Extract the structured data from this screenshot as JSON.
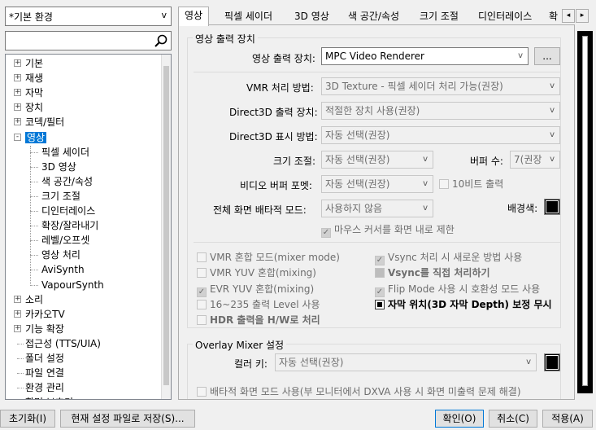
{
  "profile_select": "*기본 환경",
  "tree": {
    "items": [
      {
        "label": "기본",
        "level": 0,
        "expander": "+"
      },
      {
        "label": "재생",
        "level": 0,
        "expander": "+"
      },
      {
        "label": "자막",
        "level": 0,
        "expander": "+"
      },
      {
        "label": "장치",
        "level": 0,
        "expander": "+"
      },
      {
        "label": "코덱/필터",
        "level": 0,
        "expander": "+"
      },
      {
        "label": "영상",
        "level": 0,
        "expander": "-"
      },
      {
        "label": "픽셀 세이더",
        "level": 1
      },
      {
        "label": "3D 영상",
        "level": 1
      },
      {
        "label": "색 공간/속성",
        "level": 1
      },
      {
        "label": "크기 조절",
        "level": 1
      },
      {
        "label": "디인터레이스",
        "level": 1
      },
      {
        "label": "확장/잘라내기",
        "level": 1
      },
      {
        "label": "레벨/오프셋",
        "level": 1
      },
      {
        "label": "영상 처리",
        "level": 1
      },
      {
        "label": "AviSynth",
        "level": 1
      },
      {
        "label": "VapourSynth",
        "level": 1
      },
      {
        "label": "소리",
        "level": 0,
        "expander": "+"
      },
      {
        "label": "카카오TV",
        "level": 0,
        "expander": "+"
      },
      {
        "label": "기능 확장",
        "level": 0,
        "expander": "+"
      },
      {
        "label": "접근성 (TTS/UIA)",
        "level": 0
      },
      {
        "label": "폴더 설정",
        "level": 0
      },
      {
        "label": "파일 연결",
        "level": 0
      },
      {
        "label": "환경 관리",
        "level": 0
      },
      {
        "label": "화면 보호기",
        "level": 0
      }
    ]
  },
  "tabs": [
    "영상",
    "픽셀 세이더",
    "3D 영상",
    "색 공간/속성",
    "크기 조절",
    "디인터레이스",
    "확"
  ],
  "output_group": {
    "legend": "영상 출력 장치",
    "device_label": "영상 출력 장치:",
    "device_value": "MPC Video Renderer",
    "more_button": "...",
    "vmr_label": "VMR 처리 방법:",
    "vmr_value": "3D Texture - 픽셀 세이더 처리 가능(권장)",
    "d3d_out_label": "Direct3D 출력 장치:",
    "d3d_out_value": "적절한 장치 사용(권장)",
    "d3d_disp_label": "Direct3D 표시 방법:",
    "d3d_disp_value": "자동 선택(권장)",
    "resize_label": "크기 조절:",
    "resize_value": "자동 선택(권장)",
    "buffer_label": "버퍼 수:",
    "buffer_value": "7(권장",
    "vbuf_label": "비디오 버퍼 포멧:",
    "vbuf_value": "자동 선택(권장)",
    "tenbit_label": "10비트 출력",
    "fullscreen_label": "전체 화면 배타적 모드:",
    "fullscreen_value": "사용하지 않음",
    "bgcolor_label": "배경색:",
    "mouse_label": "마우스 커서를 화면 내로 제한",
    "checks_left": [
      "VMR 혼합 모드(mixer mode)",
      "VMR YUV 혼합(mixing)",
      "EVR YUV 혼합(mixing)",
      "16~235 출력 Level 사용",
      "HDR 출력을 H/W로 처리"
    ],
    "checks_right": [
      "Vsync 처리 시 새로운 방법 사용",
      "Vsync를 직접 처리하기",
      "Flip Mode 사용 시 호환성 모드 사용",
      "자막 위치(3D 자막 Depth) 보정 무시"
    ]
  },
  "overlay_group": {
    "legend": "Overlay Mixer 설정",
    "colorkey_label": "컬러 키:",
    "colorkey_value": "자동 선택(권장)",
    "exclusive_label": "배타적 화면 모드 사용(부 모니터에서 DXVA 사용 시 화면 미출력 문제 해결)"
  },
  "bottom": {
    "reset": "초기화(I)",
    "save_current": "현재 설정 파일로 저장(S)...",
    "ok": "확인(O)",
    "cancel": "취소(C)",
    "apply": "적용(A)"
  },
  "colors": {
    "selection": "#0078d7",
    "background": "#f0f0f0"
  }
}
